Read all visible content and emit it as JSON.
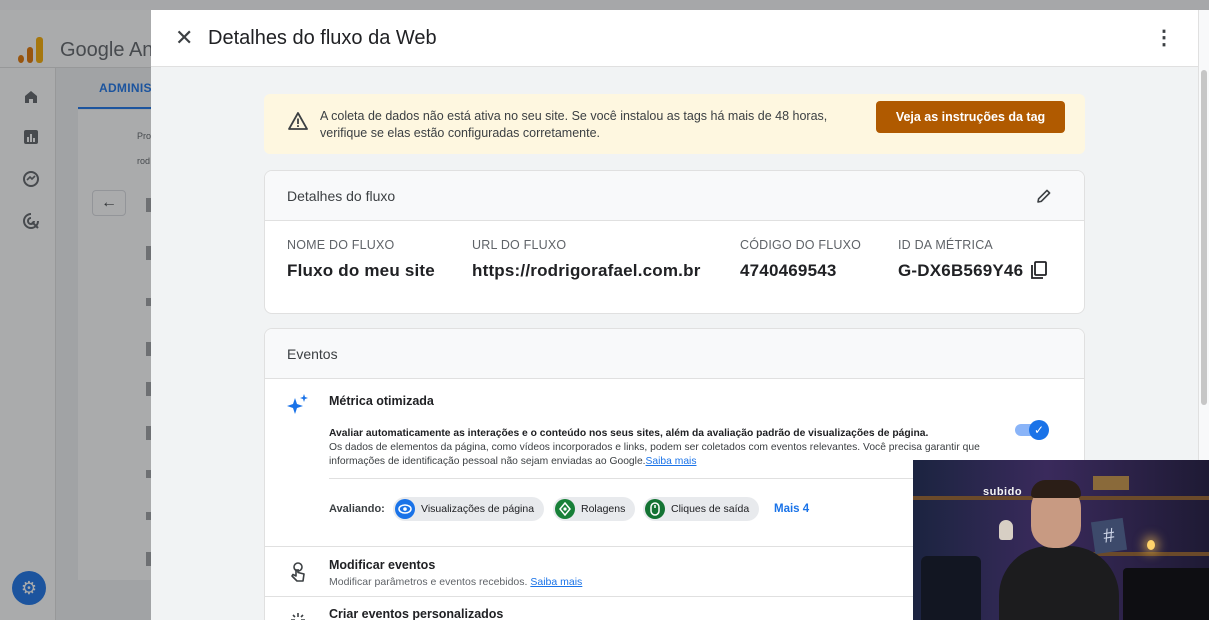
{
  "app": {
    "name": "Google An"
  },
  "background": {
    "admin_tab": "ADMINIS",
    "prop_label": "Pro",
    "rod_label": "rod"
  },
  "drawer": {
    "title": "Detalhes do fluxo da Web"
  },
  "alert": {
    "text": "A coleta de dados não está ativa no seu site. Se você instalou as tags há mais de 48 horas, verifique se elas estão configuradas corretamente.",
    "button": "Veja as instruções da tag"
  },
  "stream_details": {
    "title": "Detalhes do fluxo",
    "fields": [
      {
        "label": "NOME DO FLUXO",
        "value": "Fluxo do meu site"
      },
      {
        "label": "URL DO FLUXO",
        "value": "https://rodrigorafael.com.br"
      },
      {
        "label": "CÓDIGO DO FLUXO",
        "value": "4740469543"
      },
      {
        "label": "ID DA MÉTRICA",
        "value": "G-DX6B569Y46"
      }
    ]
  },
  "events": {
    "title": "Eventos",
    "enhanced": {
      "title": "Métrica otimizada",
      "desc_bold": "Avaliar automaticamente as interações e o conteúdo nos seus sites, além da avaliação padrão de visualizações de página.",
      "desc": "Os dados de elementos da página, como vídeos incorporados e links, podem ser coletados com eventos relevantes. Você precisa garantir que informações de identificação pessoal não sejam enviadas ao Google.",
      "learn_more": "Saiba mais",
      "toggle_on": true,
      "evaluating_label": "Avaliando:",
      "chips": [
        "Visualizações de página",
        "Rolagens",
        "Cliques de saída"
      ],
      "more": "Mais 4"
    },
    "modify": {
      "title": "Modificar eventos",
      "sub": "Modificar parâmetros e eventos recebidos.",
      "learn_more": "Saiba mais"
    },
    "create": {
      "title": "Criar eventos personalizados"
    }
  },
  "webcam": {
    "neon_text": "subido"
  },
  "colors": {
    "accent": "#1a73e8",
    "alert_button": "#b05a00",
    "alert_bg": "#fef7e0"
  }
}
